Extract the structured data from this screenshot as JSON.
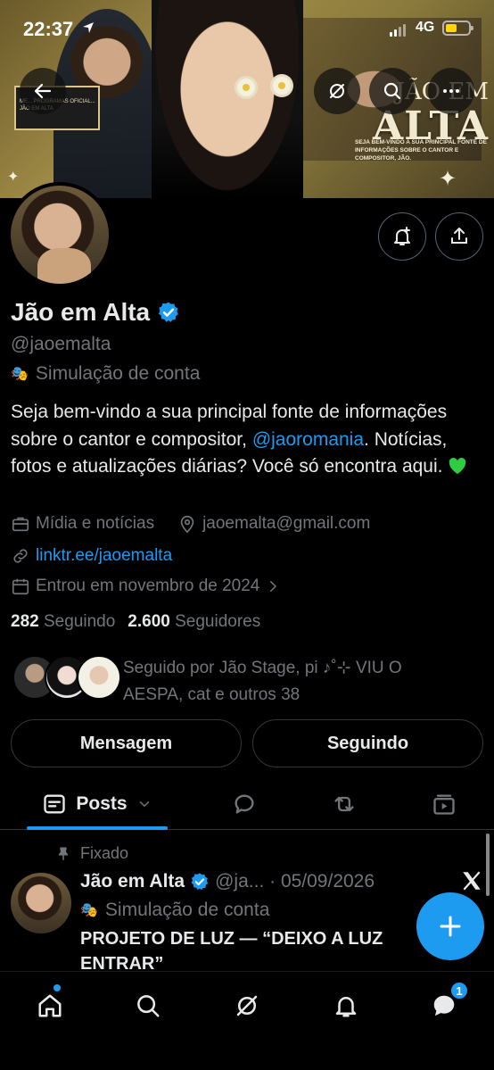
{
  "status_bar": {
    "time": "22:37",
    "network": "4G",
    "battery_color": "#ffd60a"
  },
  "banner": {
    "title_top": "JÃO EM",
    "title_bottom": "ALTA",
    "caption": "SEJA BEM-VINDO A SUA PRINCIPAL FONTE DE INFORMAÇÕES SOBRE O CANTOR E COMPOSITOR, JÃO.",
    "minicard_text": "ME... PROGRAMAS OFICIAL... JÃO EM ALTA"
  },
  "header_icons": {
    "back": "back-arrow-icon",
    "grok": "grok-icon",
    "search": "search-icon",
    "more": "more-icon"
  },
  "profile": {
    "name": "Jão em Alta",
    "handle": "@jaoemalta",
    "simulation_label": "Simulação de conta",
    "bio_part1": "Seja bem-vindo a sua principal fonte de informações sobre o cantor e compositor, ",
    "bio_mention": "@jaoromania",
    "bio_part2": ". Notícias, fotos e atualizações diárias? Você só encontra aqui.",
    "category": "Mídia e notícias",
    "email": "jaoemalta@gmail.com",
    "link": "linktr.ee/jaoemalta",
    "joined": "Entrou em novembro de 2024",
    "following_count": "282",
    "following_label": "Seguindo",
    "followers_count": "2.600",
    "followers_label": "Seguidores",
    "followed_by": "Seguido por Jão Stage, pi ♪˚⊹ VIU O AESPA, cat e outros 38"
  },
  "actions": {
    "message": "Mensagem",
    "following": "Seguindo"
  },
  "tabs": {
    "posts": "Posts"
  },
  "pinned_post": {
    "pinned_label": "Fixado",
    "author": "Jão em Alta",
    "handle_date": "@ja... · 05/09/2026",
    "simulation_label": "Simulação de conta",
    "text": "PROJETO DE LUZ — “DEIXO A LUZ ENTRAR”"
  },
  "bottom_nav": {
    "messages_badge": "1"
  },
  "colors": {
    "accent": "#1d9bf0",
    "muted": "#71767b",
    "text": "#e7e9ea",
    "heart": "#2ecc40"
  }
}
